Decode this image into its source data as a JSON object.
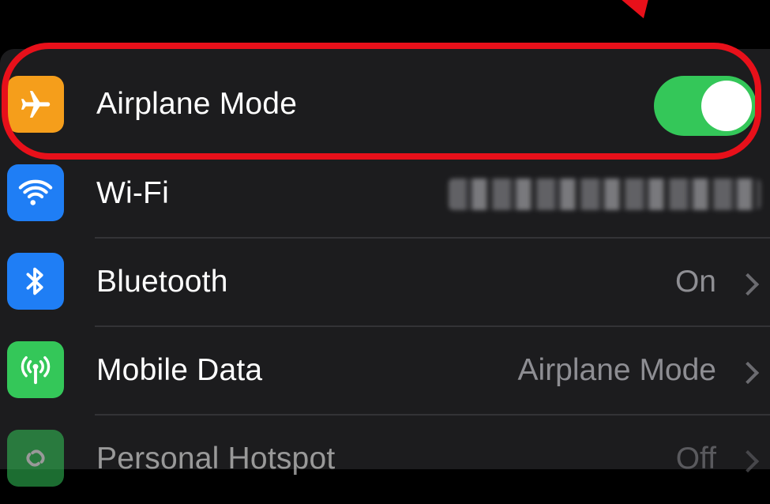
{
  "settings": {
    "rows": [
      {
        "label": "Airplane Mode",
        "icon": "airplane-icon",
        "color": "#f59e1b",
        "toggle": "on"
      },
      {
        "label": "Wi-Fi",
        "icon": "wifi-icon",
        "color": "#1f7ef5",
        "value": ""
      },
      {
        "label": "Bluetooth",
        "icon": "bluetooth-icon",
        "color": "#1f7ef5",
        "value": "On"
      },
      {
        "label": "Mobile Data",
        "icon": "antenna-icon",
        "color": "#34c759",
        "value": "Airplane Mode"
      },
      {
        "label": "Personal Hotspot",
        "icon": "hotspot-icon",
        "color": "#34c759",
        "value": "Off"
      }
    ]
  },
  "colors": {
    "background": "#000000",
    "group": "#1c1c1e",
    "highlight": "#e8101a",
    "toggle_on": "#34c759",
    "secondary_text": "#8e8e93"
  }
}
